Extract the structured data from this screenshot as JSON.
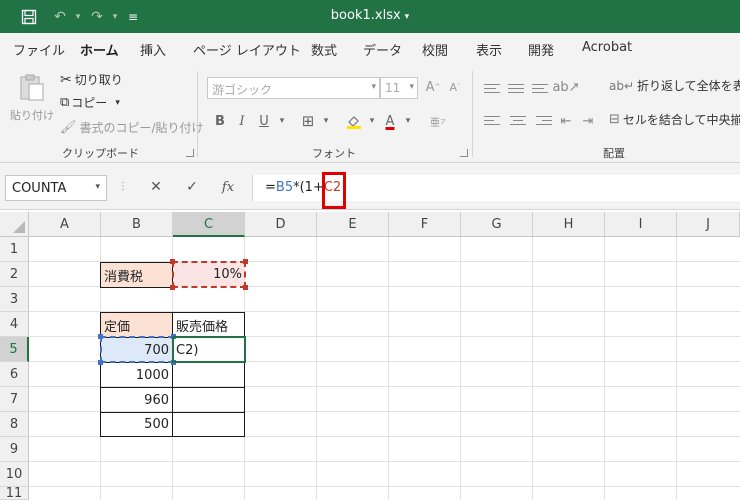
{
  "title_bar": {
    "file_name": "book1.xlsx",
    "caret": "▾"
  },
  "menu": {
    "tabs": [
      "ファイル",
      "ホーム",
      "挿入",
      "ページ レイアウト",
      "数式",
      "データ",
      "校閲",
      "表示",
      "開発",
      "Acrobat"
    ],
    "active": "ホーム"
  },
  "ribbon": {
    "clipboard": {
      "paste": "貼り付け",
      "cut": "切り取り",
      "copy": "コピー",
      "format_painter": "書式のコピー/貼り付け",
      "label": "クリップボード"
    },
    "font": {
      "font_name": "游ゴシック",
      "font_size": "11",
      "label": "フォント"
    },
    "alignment": {
      "wrap_text": "折り返して全体を表示す",
      "merge_center": "セルを結合して中央揃",
      "label": "配置"
    }
  },
  "formula_bar": {
    "name_box": "COUNTA",
    "formula_prefix": "=",
    "formula_ref_b": "B5",
    "formula_mid": "*(1+",
    "formula_ref_c": "C2"
  },
  "columns": [
    "A",
    "B",
    "C",
    "D",
    "E",
    "F",
    "G",
    "H",
    "I",
    "J"
  ],
  "rows": [
    "1",
    "2",
    "3",
    "4",
    "5",
    "6",
    "7",
    "8",
    "9",
    "10",
    "11"
  ],
  "cells": {
    "B2": "消費税",
    "C2": "10%",
    "B4": "定価",
    "C4": "販売価格",
    "B5": "700",
    "C5": "C2)",
    "B6": "1000",
    "B7": "960",
    "B8": "500"
  },
  "colors": {
    "excel_green": "#217346",
    "peach": "#fbe2d5",
    "pink": "#fce4e4",
    "ref_blue": "#4472c4",
    "ref_red": "#c0392b",
    "highlight_red": "#e00000"
  },
  "icons": [
    "save-icon",
    "undo-icon",
    "redo-icon",
    "customize-icon",
    "paste-icon",
    "cut-icon",
    "copy-icon",
    "format-painter-icon",
    "bold-icon",
    "italic-icon",
    "underline-icon",
    "borders-icon",
    "fill-color-icon",
    "font-color-icon",
    "phonetic-icon",
    "cancel-icon",
    "enter-icon",
    "function-icon"
  ]
}
